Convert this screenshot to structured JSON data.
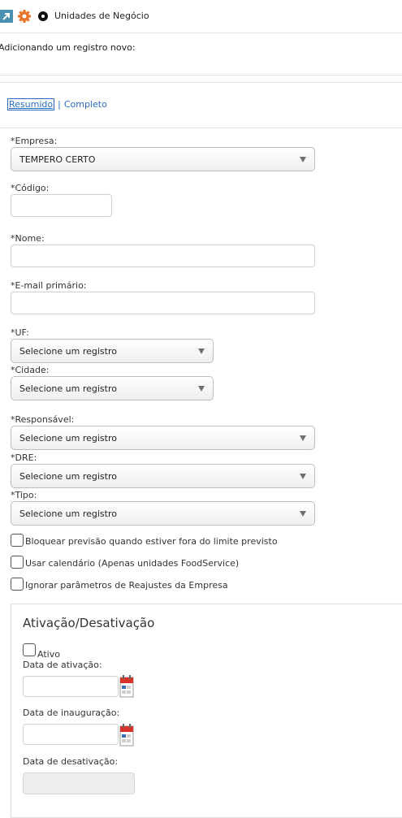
{
  "header": {
    "title": "Unidades de Negócio",
    "icons": [
      "arrow-back-icon",
      "gear-icon",
      "record-icon"
    ]
  },
  "subtitle": "Adicionando um registro novo:",
  "tabs": [
    {
      "label": "Resumido",
      "active": true
    },
    {
      "label": "Completo",
      "active": false
    }
  ],
  "form": {
    "empresa_label": "*Empresa:",
    "empresa_value": "TEMPERO CERTO",
    "codigo_label": "*Código:",
    "codigo_value": "",
    "nome_label": "*Nome:",
    "nome_value": "",
    "email_label": "*E-mail primário:",
    "email_value": "",
    "uf_label": "*UF:",
    "uf_value": "Selecione um registro",
    "cidade_label": "*Cidade:",
    "cidade_value": "Selecione um registro",
    "responsavel_label": "*Responsável:",
    "responsavel_value": "Selecione um registro",
    "dre_label": "*DRE:",
    "dre_value": "Selecione um registro",
    "tipo_label": "*Tipo:",
    "tipo_value": "Selecione um registro"
  },
  "checkboxes": [
    {
      "label": "Bloquear previsão quando estiver fora do limite previsto",
      "checked": false
    },
    {
      "label": "Usar calendário (Apenas unidades FoodService)",
      "checked": false
    },
    {
      "label": "Ignorar parâmetros de Reajustes da Empresa",
      "checked": false
    }
  ],
  "activation": {
    "title": "Ativação/Desativação",
    "ativo_label": "Ativo",
    "ativo_checked": false,
    "data_ativacao_label": "Data de ativação:",
    "data_ativacao_value": "",
    "data_inauguracao_label": "Data de inauguração:",
    "data_inauguracao_value": "",
    "data_desativacao_label": "Data de desativação:",
    "data_desativacao_value": ""
  },
  "colors": {
    "link": "#2a6cc0",
    "calendar_red": "#d9322b"
  }
}
